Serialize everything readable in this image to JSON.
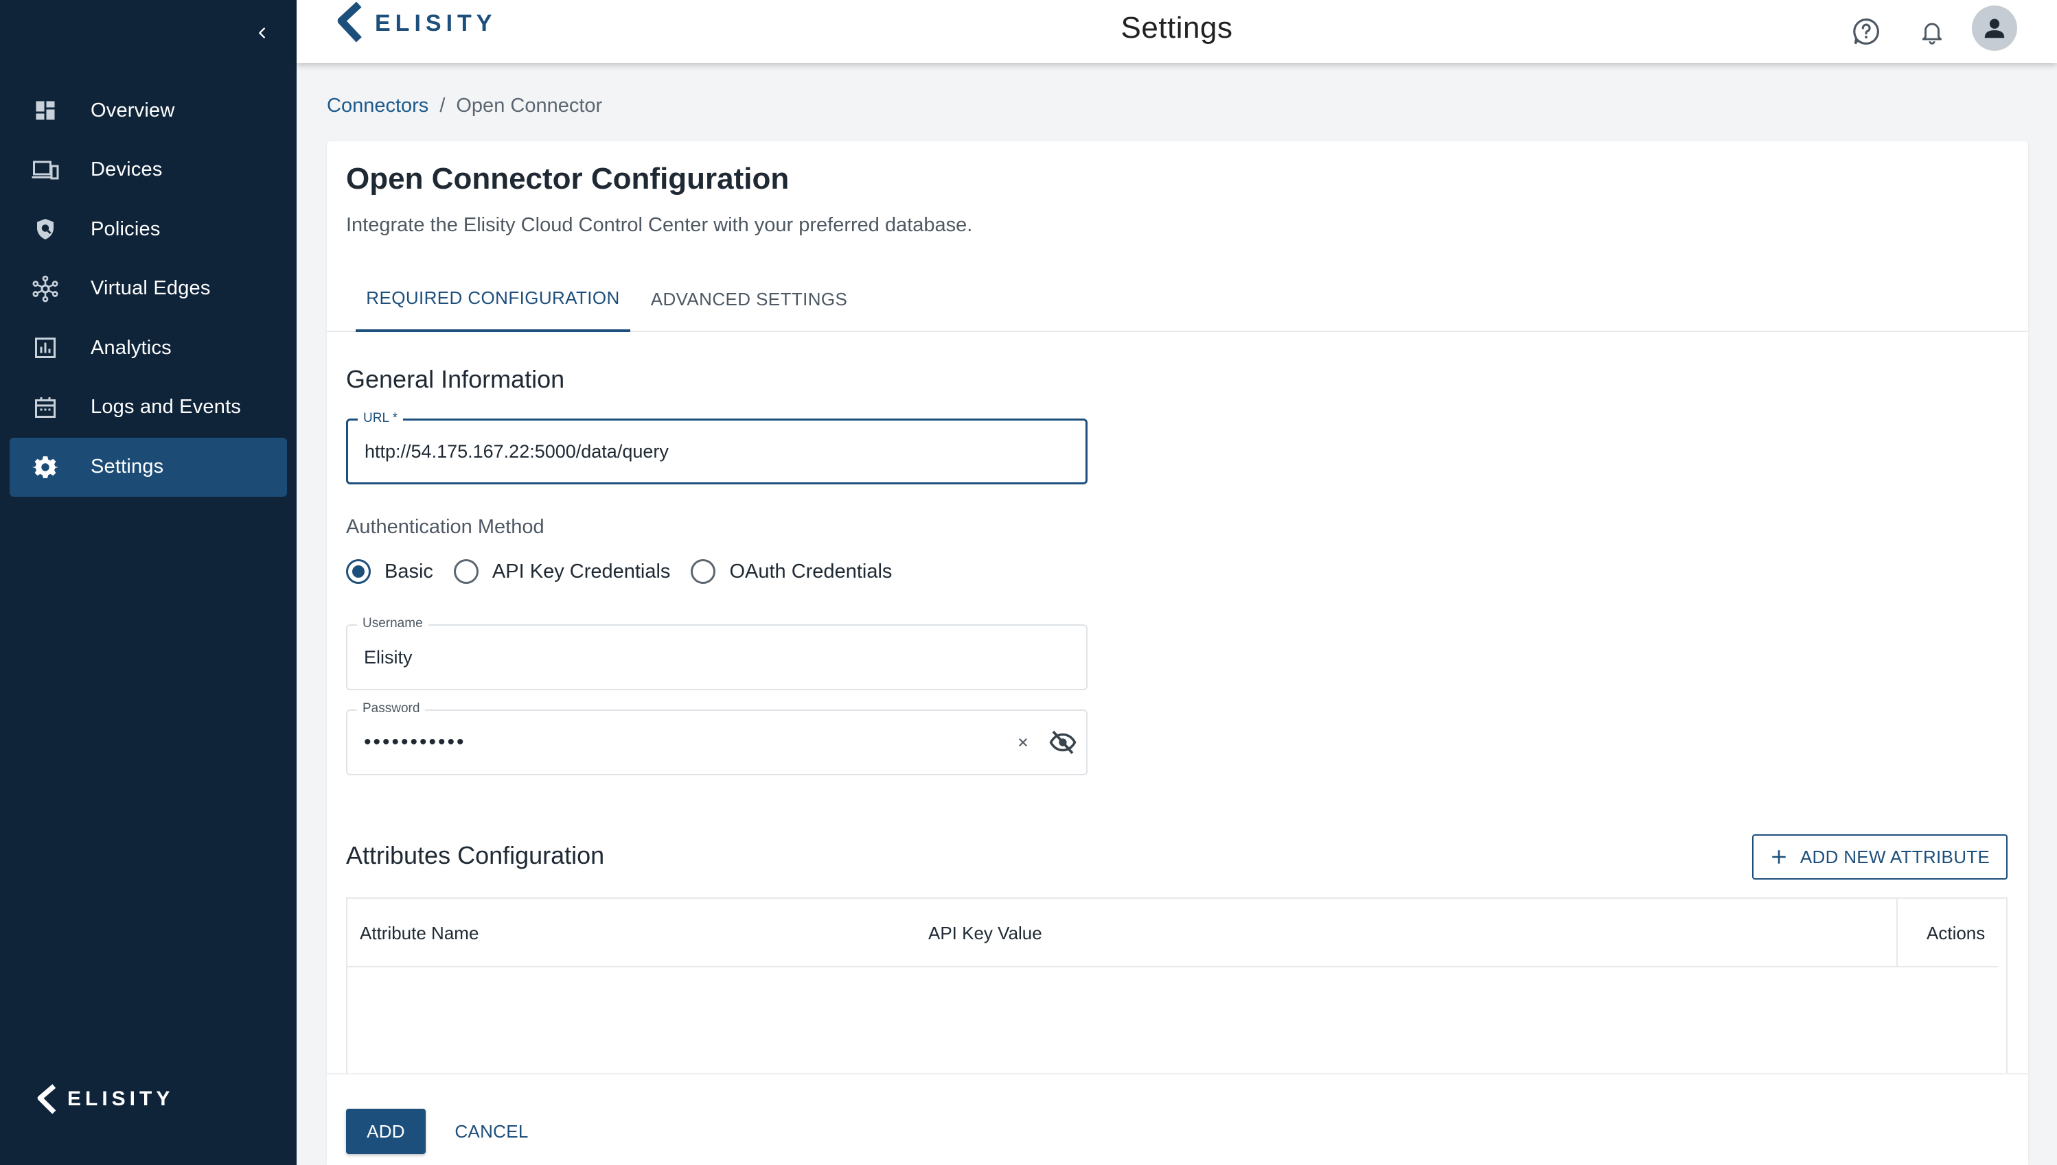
{
  "app": {
    "brand": "ELISITY",
    "page_title": "Settings"
  },
  "sidebar": {
    "collapse_icon": "chevron-left-icon",
    "items": [
      {
        "label": "Overview",
        "icon": "dashboard-icon",
        "active": false
      },
      {
        "label": "Devices",
        "icon": "devices-icon",
        "active": false
      },
      {
        "label": "Policies",
        "icon": "shield-icon",
        "active": false
      },
      {
        "label": "Virtual Edges",
        "icon": "network-hub-icon",
        "active": false
      },
      {
        "label": "Analytics",
        "icon": "bar-chart-icon",
        "active": false
      },
      {
        "label": "Logs and Events",
        "icon": "calendar-icon",
        "active": false
      },
      {
        "label": "Settings",
        "icon": "gear-icon",
        "active": true
      }
    ],
    "footer_brand": "ELISITY"
  },
  "header": {
    "icons": [
      "help-icon",
      "bell-icon",
      "user-avatar-icon"
    ]
  },
  "breadcrumb": {
    "parent": "Connectors",
    "separator": "/",
    "current": "Open Connector"
  },
  "card": {
    "title": "Open Connector Configuration",
    "subtitle": "Integrate the Elisity Cloud Control Center with your preferred database.",
    "tabs": [
      {
        "label": "REQUIRED CONFIGURATION",
        "active": true
      },
      {
        "label": "ADVANCED SETTINGS",
        "active": false
      }
    ]
  },
  "general": {
    "title": "General Information",
    "url_label": "URL *",
    "url_value": "http://54.175.167.22:5000/data/query"
  },
  "auth": {
    "label": "Authentication Method",
    "options": [
      {
        "label": "Basic",
        "checked": true
      },
      {
        "label": "API Key Credentials",
        "checked": false
      },
      {
        "label": "OAuth Credentials",
        "checked": false
      }
    ],
    "username_label": "Username",
    "username_value": "Elisity",
    "password_label": "Password",
    "password_value": "•••••••••••",
    "clear_icon": "close-icon",
    "visibility_icon": "eye-off-icon"
  },
  "attributes": {
    "title": "Attributes Configuration",
    "add_button": "ADD NEW ATTRIBUTE",
    "columns": [
      "Attribute Name",
      "API Key Value",
      "Actions"
    ],
    "rows": []
  },
  "footer": {
    "add_label": "ADD",
    "cancel_label": "CANCEL"
  },
  "colors": {
    "sidebar_bg": "#0f2439",
    "sidebar_active": "#1c4b75",
    "primary": "#1d4f7c",
    "page_bg": "#f3f4f6"
  }
}
